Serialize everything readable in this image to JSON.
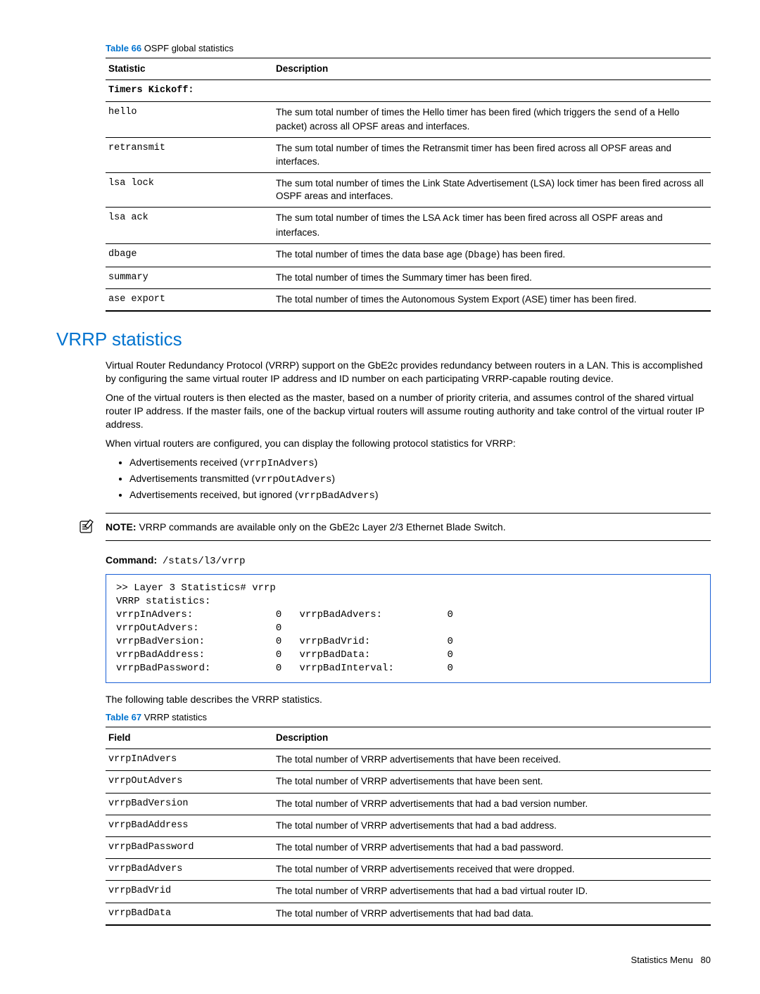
{
  "table66": {
    "caption_num": "Table 66",
    "caption_text": "OSPF global statistics",
    "header_stat": "Statistic",
    "header_desc": "Description",
    "section": "Timers Kickoff:",
    "rows": [
      {
        "stat": "hello",
        "d1": "The sum total number of times the Hello timer has been fired (which triggers the ",
        "code": "send",
        "d2": " of a Hello packet) across all OPSF areas and interfaces."
      },
      {
        "stat": "retransmit",
        "d1": "The sum total number of times the Retransmit timer has been fired across all OPSF areas and interfaces.",
        "code": "",
        "d2": ""
      },
      {
        "stat": "lsa lock",
        "d1": "The sum total number of times the Link State Advertisement (LSA) lock timer has been fired across all OSPF areas and interfaces.",
        "code": "",
        "d2": ""
      },
      {
        "stat": "lsa ack",
        "d1": "The sum total number of times the LSA ",
        "code": "Ack",
        "d2": " timer has been fired across all OSPF areas and interfaces."
      },
      {
        "stat": "dbage",
        "d1": "The total number of times the data base age (",
        "code": "Dbage",
        "d2": ") has been fired."
      },
      {
        "stat": "summary",
        "d1": "The total number of times the Summary timer has been fired.",
        "code": "",
        "d2": ""
      },
      {
        "stat": "ase export",
        "d1": "The total number of times the Autonomous System Export (ASE) timer has been fired.",
        "code": "",
        "d2": ""
      }
    ]
  },
  "vrrp_heading": "VRRP statistics",
  "para1": "Virtual Router Redundancy Protocol (VRRP) support on the GbE2c provides redundancy between routers in a LAN. This is accomplished by configuring the same virtual router IP address and ID number on each participating VRRP-capable routing device.",
  "para2": "One of the virtual routers is then elected as the master, based on a number of priority criteria, and assumes control of the shared virtual router IP address. If the master fails, one of the backup virtual routers will assume routing authority and take control of the virtual router IP address.",
  "para3": "When virtual routers are configured, you can display the following protocol statistics for VRRP:",
  "bullets": [
    {
      "t1": "Advertisements received (",
      "code": "vrrpInAdvers",
      "t2": ")"
    },
    {
      "t1": "Advertisements transmitted (",
      "code": "vrrpOutAdvers",
      "t2": ")"
    },
    {
      "t1": "Advertisements received, but ignored (",
      "code": "vrrpBadAdvers",
      "t2": ")"
    }
  ],
  "note_label": "NOTE:",
  "note_text": " VRRP commands are available only on the GbE2c Layer 2/3 Ethernet Blade Switch.",
  "command_label": "Command:",
  "command_path": "/stats/l3/vrrp",
  "code_block": ">> Layer 3 Statistics# vrrp\nVRRP statistics:\nvrrpInAdvers:              0   vrrpBadAdvers:           0\nvrrpOutAdvers:             0\nvrrpBadVersion:            0   vrrpBadVrid:             0\nvrrpBadAddress:            0   vrrpBadData:             0\nvrrpBadPassword:           0   vrrpBadInterval:         0",
  "para4": "The following table describes the VRRP statistics.",
  "table67": {
    "caption_num": "Table 67",
    "caption_text": "VRRP statistics",
    "header_field": "Field",
    "header_desc": "Description",
    "rows": [
      {
        "f": "vrrpInAdvers",
        "d": "The total number of VRRP advertisements that have been received."
      },
      {
        "f": "vrrpOutAdvers",
        "d": "The total number of VRRP advertisements that have been sent."
      },
      {
        "f": "vrrpBadVersion",
        "d": "The total number of VRRP advertisements that had a bad version number."
      },
      {
        "f": "vrrpBadAddress",
        "d": "The total number of VRRP advertisements that had a bad address."
      },
      {
        "f": "vrrpBadPassword",
        "d": "The total number of VRRP advertisements that had a bad password."
      },
      {
        "f": "vrrpBadAdvers",
        "d": "The total number of VRRP advertisements received that were dropped."
      },
      {
        "f": "vrrpBadVrid",
        "d": "The total number of VRRP advertisements that had a bad virtual router ID."
      },
      {
        "f": "vrrpBadData",
        "d": "The total number of VRRP advertisements that had bad data."
      }
    ]
  },
  "footer_text": "Statistics Menu",
  "footer_page": "80"
}
